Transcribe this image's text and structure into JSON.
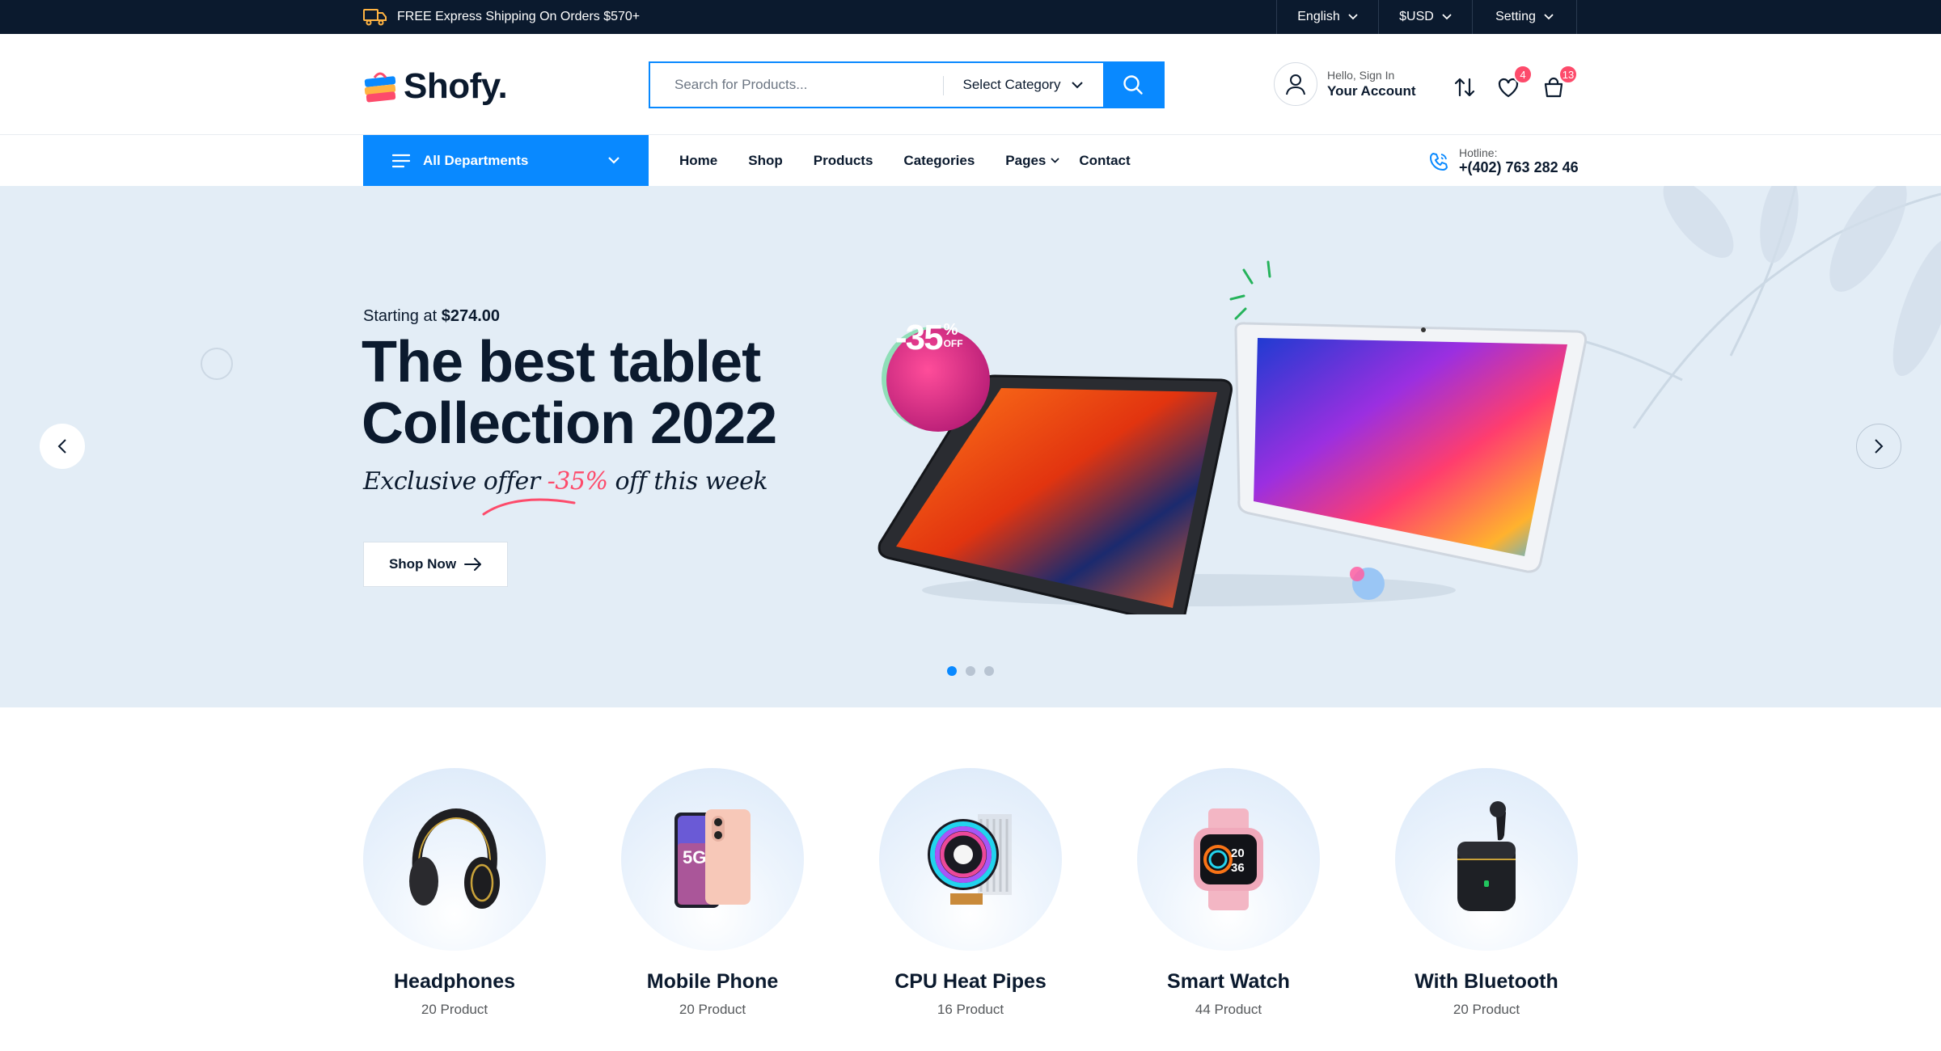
{
  "topbar": {
    "shipping_text": "FREE Express Shipping On Orders $570+",
    "language": "English",
    "currency": "$USD",
    "setting": "Setting"
  },
  "header": {
    "logo_text": "Shofy.",
    "search_placeholder": "Search for Products...",
    "category_select": "Select Category",
    "account_greeting": "Hello, Sign In",
    "account_label": "Your Account",
    "wishlist_count": "4",
    "cart_count": "13"
  },
  "nav": {
    "departments_label": "All Departments",
    "items": [
      {
        "label": "Home"
      },
      {
        "label": "Shop"
      },
      {
        "label": "Products"
      },
      {
        "label": "Categories"
      },
      {
        "label": "Pages"
      },
      {
        "label": "Contact"
      }
    ],
    "hotline_label": "Hotline:",
    "hotline_number": "+(402) 763 282 46"
  },
  "hero": {
    "starting_prefix": "Starting at ",
    "starting_price": "$274.00",
    "title_line1": "The best tablet",
    "title_line2": "Collection 2022",
    "offer_prefix": "Exclusive offer ",
    "offer_pct": "-35%",
    "offer_suffix": " off this week",
    "shop_now": "Shop Now",
    "badge_value": "-35",
    "badge_pct": "%",
    "badge_off": "OFF",
    "slides": 3,
    "active_slide": 1,
    "colors": {
      "accent": "#0989ff",
      "sale": "#fd4b6b",
      "background": "#e3edf6"
    }
  },
  "categories": [
    {
      "name": "Headphones",
      "count": "20 Product",
      "icon": "headphones-icon"
    },
    {
      "name": "Mobile Phone",
      "count": "20 Product",
      "icon": "mobile-phone-icon"
    },
    {
      "name": "CPU Heat Pipes",
      "count": "16 Product",
      "icon": "cpu-cooler-icon"
    },
    {
      "name": "Smart Watch",
      "count": "44 Product",
      "icon": "smart-watch-icon"
    },
    {
      "name": "With Bluetooth",
      "count": "20 Product",
      "icon": "earbuds-icon"
    }
  ]
}
